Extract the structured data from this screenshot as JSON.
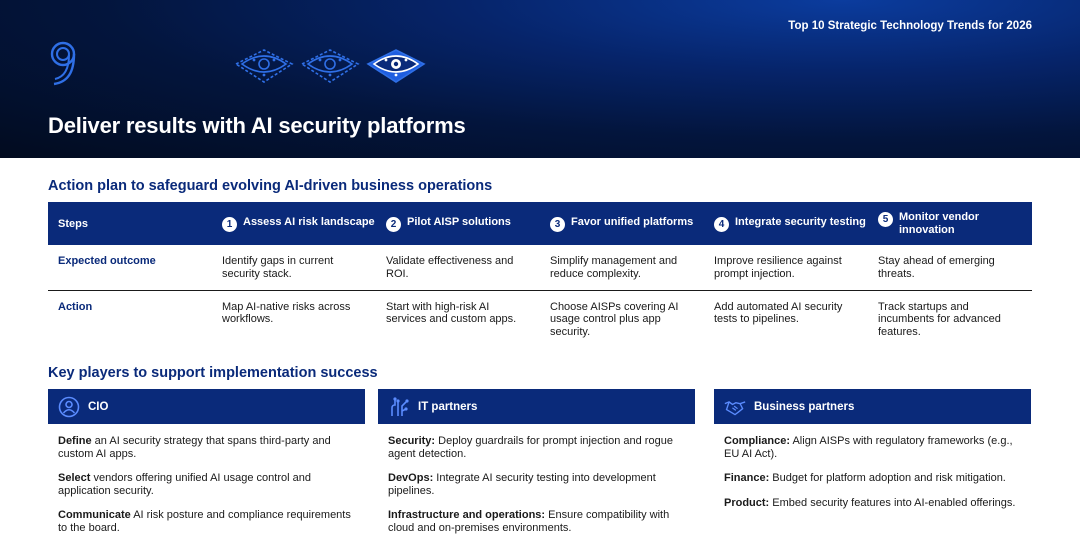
{
  "banner": {
    "report_title": "Top 10 Strategic Technology Trends for 2026",
    "number_icon": "digit-9-outline",
    "trend_icons": [
      "eye-shield-icon",
      "eye-shield-icon",
      "eye-shield-active-icon"
    ],
    "title": "Deliver results with AI security platforms"
  },
  "action_plan": {
    "heading": "Action plan to safeguard evolving AI-driven business operations",
    "steps_label": "Steps",
    "steps": [
      {
        "number": "1",
        "title": "Assess AI risk landscape",
        "outcome": "Identify gaps in current security stack.",
        "action": "Map AI-native risks across workflows."
      },
      {
        "number": "2",
        "title": "Pilot AISP solutions",
        "outcome": "Validate effectiveness and ROI.",
        "action": "Start with high-risk AI services and custom apps."
      },
      {
        "number": "3",
        "title": "Favor unified platforms",
        "outcome": "Simplify management and reduce complexity.",
        "action": "Choose AISPs covering AI usage control plus app security."
      },
      {
        "number": "4",
        "title": "Integrate security testing",
        "outcome": "Improve resilience against prompt injection.",
        "action": "Add automated AI security tests to pipelines."
      },
      {
        "number": "5",
        "title": "Monitor vendor innovation",
        "outcome": "Stay ahead of emerging threats.",
        "action": "Track startups and incumbents for advanced features."
      }
    ],
    "row_labels": {
      "outcome": "Expected outcome",
      "action": "Action"
    }
  },
  "key_players": {
    "heading": "Key players to support implementation success",
    "cards": [
      {
        "title": "CIO",
        "icon": "person-circle-icon",
        "items": [
          {
            "lead": "Define",
            "text": " an AI security strategy that spans third-party and custom AI apps."
          },
          {
            "lead": "Select",
            "text": " vendors offering unified AI usage control and application security."
          },
          {
            "lead": "Communicate",
            "text": " AI risk posture and compliance requirements to the board."
          }
        ]
      },
      {
        "title": "IT partners",
        "icon": "circuit-hand-icon",
        "items": [
          {
            "lead": "Security:",
            "text": " Deploy guardrails for prompt injection and rogue agent detection."
          },
          {
            "lead": "DevOps:",
            "text": " Integrate AI security testing into development pipelines."
          },
          {
            "lead": "Infrastructure and operations:",
            "text": " Ensure compatibility with cloud and on-premises environments."
          }
        ]
      },
      {
        "title": "Business partners",
        "icon": "handshake-icon",
        "items": [
          {
            "lead": "Compliance:",
            "text": " Align AISPs with regulatory frameworks (e.g., EU AI Act)."
          },
          {
            "lead": "Finance:",
            "text": " Budget for platform adoption and risk mitigation."
          },
          {
            "lead": "Product:",
            "text": " Embed security features into AI-enabled offerings."
          }
        ]
      }
    ]
  }
}
